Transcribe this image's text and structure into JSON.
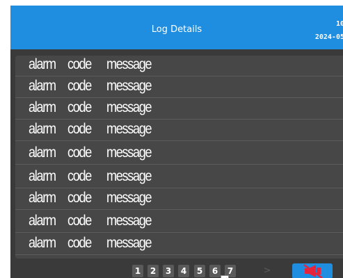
{
  "header": {
    "title": "Log Details",
    "time": "10",
    "date": "2024-05"
  },
  "log_rows": [
    {
      "alarm": "alarm",
      "code": "code",
      "message": "message"
    },
    {
      "alarm": "alarm",
      "code": "code",
      "message": "message"
    },
    {
      "alarm": "alarm",
      "code": "code",
      "message": "message"
    },
    {
      "alarm": "alarm",
      "code": "code",
      "message": "message"
    },
    {
      "alarm": "alarm",
      "code": "code",
      "message": "message"
    },
    {
      "alarm": "alarm",
      "code": "code",
      "message": "message"
    },
    {
      "alarm": "alarm",
      "code": "code",
      "message": "message"
    },
    {
      "alarm": "alarm",
      "code": "code",
      "message": "message"
    },
    {
      "alarm": "alarm",
      "code": "code",
      "message": "message"
    }
  ],
  "pagination": {
    "pages": [
      "1",
      "2",
      "3",
      "4",
      "5",
      "6",
      "7"
    ],
    "next_symbol": ">"
  },
  "icons": {
    "mute": "speaker-muted-icon",
    "check": "checkbox-icon"
  },
  "colors": {
    "header_blue": "#1f8ee0",
    "background": "#3a3a3a",
    "panel": "#474747",
    "mute_red": "#e8233c"
  }
}
